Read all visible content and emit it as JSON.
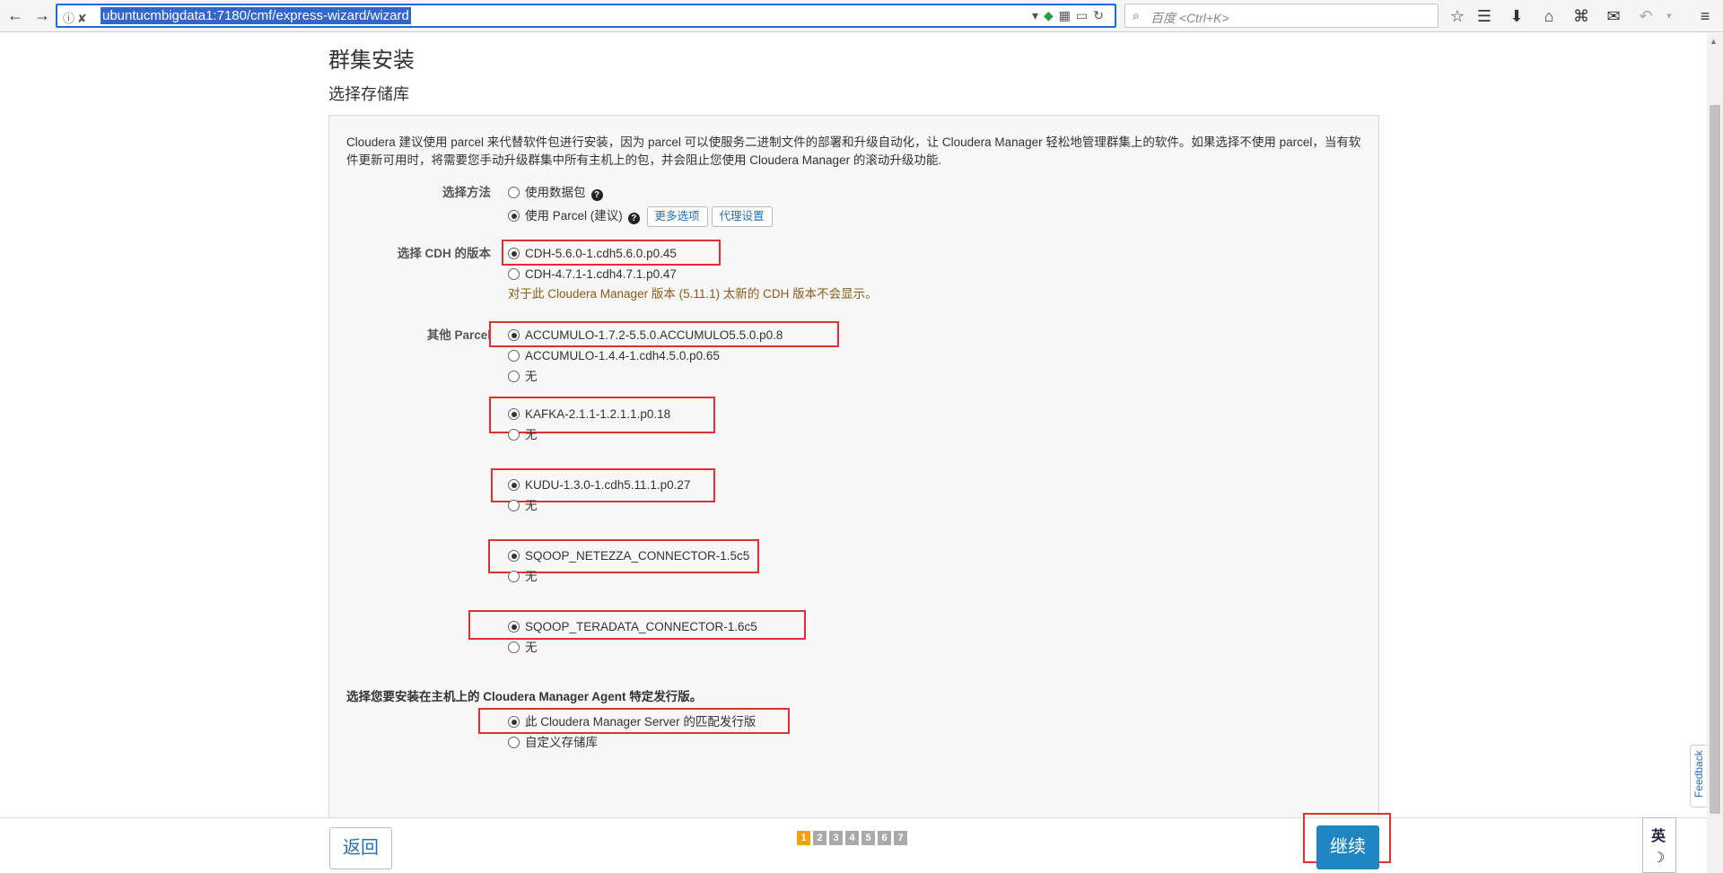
{
  "browser": {
    "url": "ubuntucmbigdata1:7180/cmf/express-wizard/wizard",
    "search_placeholder": "百度 <Ctrl+K>"
  },
  "page": {
    "title": "群集安装",
    "subtitle": "选择存储库",
    "intro": "Cloudera 建议使用 parcel 来代替软件包进行安装，因为 parcel 可以使服务二进制文件的部署和升级自动化，让 Cloudera Manager 轻松地管理群集上的软件。如果选择不使用 parcel，当有软件更新可用时，将需要您手动升级群集中所有主机上的包，并会阻止您使用 Cloudera Manager 的滚动升级功能."
  },
  "method": {
    "label": "选择方法",
    "option_packages": "使用数据包",
    "option_parcel": "使用 Parcel (建议)",
    "more_options_label": "更多选项",
    "proxy_settings_label": "代理设置",
    "selected": "parcel"
  },
  "cdh": {
    "label": "选择 CDH 的版本",
    "options": [
      "CDH-5.6.0-1.cdh5.6.0.p0.45",
      "CDH-4.7.1-1.cdh4.7.1.p0.47"
    ],
    "selected": 0,
    "notice": "对于此 Cloudera Manager 版本 (5.11.1) 太新的 CDH 版本不会显示。"
  },
  "other_parcels": {
    "label": "其他 Parcel",
    "accumulo": [
      "ACCUMULO-1.7.2-5.5.0.ACCUMULO5.5.0.p0.8",
      "ACCUMULO-1.4.4-1.cdh4.5.0.p0.65",
      "无"
    ],
    "kafka": [
      "KAFKA-2.1.1-1.2.1.1.p0.18",
      "无"
    ],
    "kudu": [
      "KUDU-1.3.0-1.cdh5.11.1.p0.27",
      "无"
    ],
    "sqoop_netezza": [
      "SQOOP_NETEZZA_CONNECTOR-1.5c5",
      "无"
    ],
    "sqoop_teradata": [
      "SQOOP_TERADATA_CONNECTOR-1.6c5",
      "无"
    ]
  },
  "agent": {
    "label": "选择您要安装在主机上的 Cloudera Manager Agent 特定发行版。",
    "option_matched": "此 Cloudera Manager Server 的匹配发行版",
    "option_custom": "自定义存储库"
  },
  "footer": {
    "back_label": "返回",
    "continue_label": "继续",
    "steps": [
      "1",
      "2",
      "3",
      "4",
      "5",
      "6",
      "7"
    ],
    "active_step": "1"
  },
  "side": {
    "feedback_label": "Feedback",
    "ime_label": "英",
    "ime_mode_icon": "☽"
  },
  "colors": {
    "highlight": "#e03030",
    "accent": "#1f86c3",
    "active_step": "#f0a30a"
  }
}
